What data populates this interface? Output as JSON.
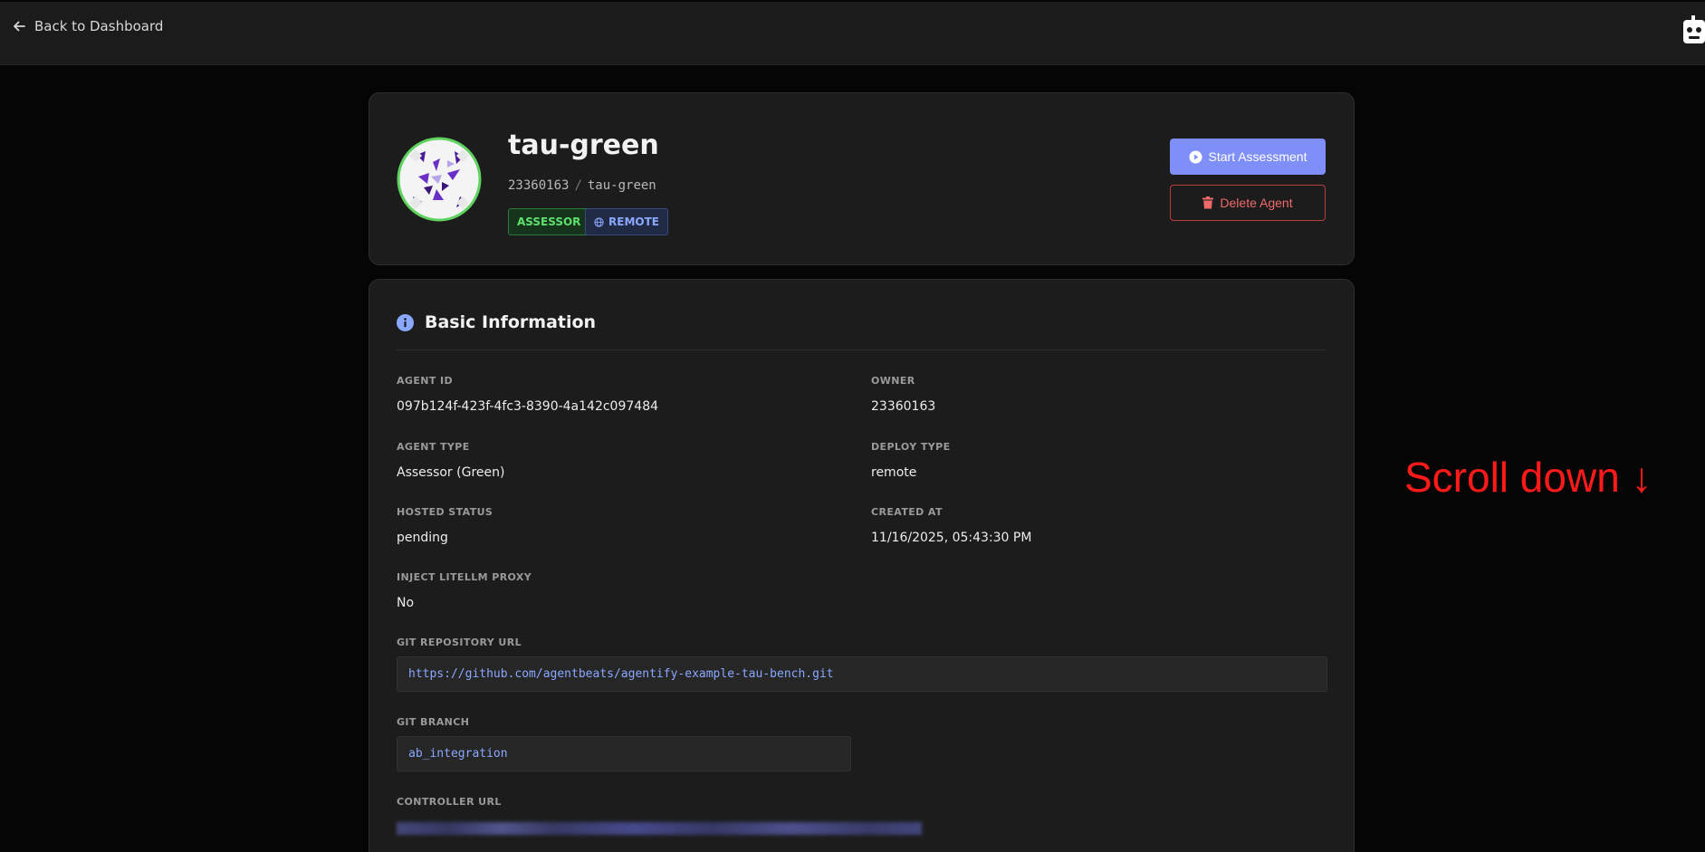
{
  "topbar": {
    "back_label": "Back to Dashboard"
  },
  "agent": {
    "name": "tau-green",
    "owner": "23360163",
    "slug": "tau-green",
    "badges": {
      "assessor": "ASSESSOR",
      "remote": "REMOTE"
    }
  },
  "actions": {
    "start_label": "Start Assessment",
    "delete_label": "Delete Agent"
  },
  "basic_info": {
    "title": "Basic Information",
    "agent_id_label": "AGENT ID",
    "agent_id": "097b124f-423f-4fc3-8390-4a142c097484",
    "owner_label": "OWNER",
    "owner": "23360163",
    "agent_type_label": "AGENT TYPE",
    "agent_type": "Assessor (Green)",
    "deploy_type_label": "DEPLOY TYPE",
    "deploy_type": "remote",
    "hosted_status_label": "HOSTED STATUS",
    "hosted_status": "pending",
    "created_at_label": "CREATED AT",
    "created_at": "11/16/2025, 05:43:30 PM",
    "inject_label": "INJECT LITELLM PROXY",
    "inject": "No",
    "git_repo_label": "GIT REPOSITORY URL",
    "git_repo": "https://github.com/agentbeats/agentify-example-tau-bench.git",
    "git_branch_label": "GIT BRANCH",
    "git_branch": "ab_integration",
    "controller_label": "CONTROLLER URL"
  },
  "overlay": {
    "scroll_hint": "Scroll down ↓"
  },
  "colors": {
    "accent": "#7f8ff8",
    "danger": "#f06a6a",
    "assessor_green": "#5ee06e",
    "remote_blue": "#8aa8ff",
    "hint_red": "#ff1a1a"
  },
  "icons": [
    "arrow-left-icon",
    "robot-icon",
    "play-circle-icon",
    "trash-icon",
    "globe-icon",
    "info-icon"
  ]
}
